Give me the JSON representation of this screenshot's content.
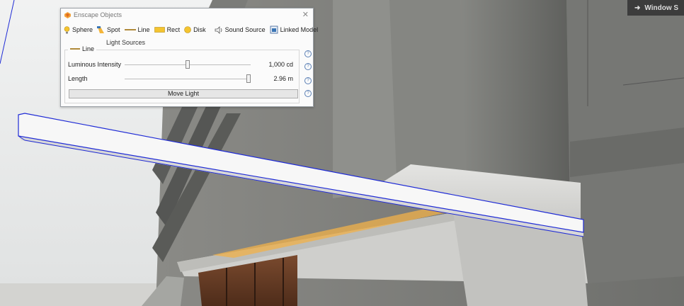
{
  "dialog": {
    "title": "Enscape Objects",
    "tools": [
      {
        "name": "sphere",
        "label": "Sphere"
      },
      {
        "name": "spot",
        "label": "Spot"
      },
      {
        "name": "line",
        "label": "Line"
      },
      {
        "name": "rect",
        "label": "Rect"
      },
      {
        "name": "disk",
        "label": "Disk"
      },
      {
        "name": "sound",
        "label": "Sound Source"
      },
      {
        "name": "linked",
        "label": "Linked Model"
      }
    ],
    "light_sources_label": "Light Sources",
    "group_title": "Line",
    "luminous_label": "Luminous Intensity",
    "luminous_value": "1,000 cd",
    "luminous_fraction": 0.5,
    "length_label": "Length",
    "length_value": "2.96 m",
    "length_fraction": 1.0,
    "move_label": "Move Light"
  },
  "window_button": {
    "label": "Window S"
  },
  "colors": {
    "selection": "#1f2bd6",
    "concrete": "#9a9b98",
    "wood": "#6b4028",
    "light_glow": "#f2b24a"
  }
}
